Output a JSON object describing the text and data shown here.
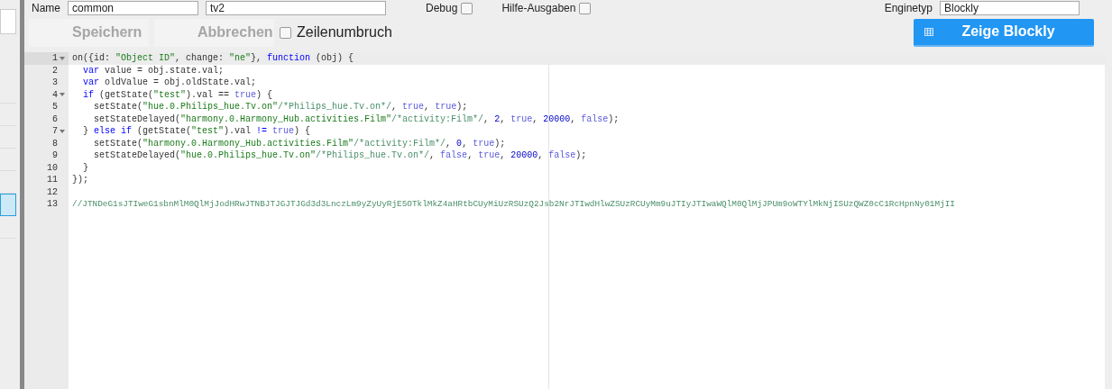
{
  "header": {
    "name_label": "Name",
    "group_select": "common",
    "name_value": "tv2",
    "debug": {
      "label": "Debug",
      "checked": false
    },
    "verbose": {
      "label": "Hilfe-Ausgaben",
      "checked": false
    },
    "engine_label": "Enginetyp",
    "engine_select": "Blockly"
  },
  "sidebar": {
    "rows": [
      {
        "selected": false
      },
      {
        "selected": false
      },
      {
        "selected": false
      },
      {
        "selected": false
      },
      {
        "selected": false
      },
      {
        "selected": true
      },
      {
        "selected": false
      }
    ]
  },
  "toolbar": {
    "save": {
      "label": "Speichern",
      "disabled": true
    },
    "cancel": {
      "label": "Abbrechen",
      "disabled": true
    },
    "wrap": {
      "label": "Zeilenumbruch",
      "checked": false
    },
    "blockly": {
      "label": "Zeige Blockly"
    }
  },
  "editor": {
    "lines": [
      {
        "number": "1",
        "foldable": true,
        "active": true,
        "tokens": [
          {
            "kind": "plain",
            "text": "on({id: "
          },
          {
            "kind": "string",
            "text": "\"Object ID\""
          },
          {
            "kind": "plain",
            "text": ", change: "
          },
          {
            "kind": "string",
            "text": "\"ne\""
          },
          {
            "kind": "plain",
            "text": "}, "
          },
          {
            "kind": "keyword",
            "text": "function"
          },
          {
            "kind": "plain",
            "text": " (obj) {"
          }
        ]
      },
      {
        "number": "2",
        "foldable": false,
        "active": false,
        "tokens": [
          {
            "kind": "keyword",
            "text": "  var"
          },
          {
            "kind": "plain",
            "text": " value = obj.state.val;"
          }
        ]
      },
      {
        "number": "3",
        "foldable": false,
        "active": false,
        "tokens": [
          {
            "kind": "keyword",
            "text": "  var"
          },
          {
            "kind": "plain",
            "text": " oldValue = obj.oldState.val;"
          }
        ]
      },
      {
        "number": "4",
        "foldable": true,
        "active": false,
        "tokens": [
          {
            "kind": "keyword",
            "text": "  if"
          },
          {
            "kind": "plain",
            "text": " (getState("
          },
          {
            "kind": "string",
            "text": "\"test\""
          },
          {
            "kind": "plain",
            "text": ").val == "
          },
          {
            "kind": "atom",
            "text": "true"
          },
          {
            "kind": "plain",
            "text": ") {"
          }
        ]
      },
      {
        "number": "5",
        "foldable": false,
        "active": false,
        "tokens": [
          {
            "kind": "plain",
            "text": "    setState("
          },
          {
            "kind": "string",
            "text": "\"hue.0.Philips_hue.Tv.on\""
          },
          {
            "kind": "comment",
            "text": "/*Philips_hue.Tv.on*/"
          },
          {
            "kind": "plain",
            "text": ", "
          },
          {
            "kind": "atom",
            "text": "true"
          },
          {
            "kind": "plain",
            "text": ", "
          },
          {
            "kind": "atom",
            "text": "true"
          },
          {
            "kind": "plain",
            "text": ");"
          }
        ]
      },
      {
        "number": "6",
        "foldable": false,
        "active": false,
        "tokens": [
          {
            "kind": "plain",
            "text": "    setStateDelayed("
          },
          {
            "kind": "string",
            "text": "\"harmony.0.Harmony_Hub.activities.Film\""
          },
          {
            "kind": "comment",
            "text": "/*activity:Film*/"
          },
          {
            "kind": "plain",
            "text": ", "
          },
          {
            "kind": "number",
            "text": "2"
          },
          {
            "kind": "plain",
            "text": ", "
          },
          {
            "kind": "atom",
            "text": "true"
          },
          {
            "kind": "plain",
            "text": ", "
          },
          {
            "kind": "number",
            "text": "20000"
          },
          {
            "kind": "plain",
            "text": ", "
          },
          {
            "kind": "atom",
            "text": "false"
          },
          {
            "kind": "plain",
            "text": ");"
          }
        ]
      },
      {
        "number": "7",
        "foldable": true,
        "active": false,
        "tokens": [
          {
            "kind": "plain",
            "text": "  } "
          },
          {
            "kind": "keyword",
            "text": "else if"
          },
          {
            "kind": "plain",
            "text": " (getState("
          },
          {
            "kind": "string",
            "text": "\"test\""
          },
          {
            "kind": "plain",
            "text": ").val "
          },
          {
            "kind": "keyword",
            "text": "!="
          },
          {
            "kind": "atom",
            "text": " true"
          },
          {
            "kind": "plain",
            "text": ") {"
          }
        ]
      },
      {
        "number": "8",
        "foldable": false,
        "active": false,
        "tokens": [
          {
            "kind": "plain",
            "text": "    setState("
          },
          {
            "kind": "string",
            "text": "\"harmony.0.Harmony_Hub.activities.Film\""
          },
          {
            "kind": "comment",
            "text": "/*activity:Film*/"
          },
          {
            "kind": "plain",
            "text": ", "
          },
          {
            "kind": "number",
            "text": "0"
          },
          {
            "kind": "plain",
            "text": ", "
          },
          {
            "kind": "atom",
            "text": "true"
          },
          {
            "kind": "plain",
            "text": ");"
          }
        ]
      },
      {
        "number": "9",
        "foldable": false,
        "active": false,
        "tokens": [
          {
            "kind": "plain",
            "text": "    setStateDelayed("
          },
          {
            "kind": "string",
            "text": "\"hue.0.Philips_hue.Tv.on\""
          },
          {
            "kind": "comment",
            "text": "/*Philips_hue.Tv.on*/"
          },
          {
            "kind": "plain",
            "text": ", "
          },
          {
            "kind": "atom",
            "text": "false"
          },
          {
            "kind": "plain",
            "text": ", "
          },
          {
            "kind": "atom",
            "text": "true"
          },
          {
            "kind": "plain",
            "text": ", "
          },
          {
            "kind": "number",
            "text": "20000"
          },
          {
            "kind": "plain",
            "text": ", "
          },
          {
            "kind": "atom",
            "text": "false"
          },
          {
            "kind": "plain",
            "text": ");"
          }
        ]
      },
      {
        "number": "10",
        "foldable": false,
        "active": false,
        "tokens": [
          {
            "kind": "plain",
            "text": "  }"
          }
        ]
      },
      {
        "number": "11",
        "foldable": false,
        "active": false,
        "tokens": [
          {
            "kind": "plain",
            "text": "});"
          }
        ]
      },
      {
        "number": "12",
        "foldable": false,
        "active": false
      },
      {
        "number": "13",
        "foldable": false,
        "active": false,
        "tokens": [
          {
            "kind": "comment",
            "text": "//JTNDeG1sJTIweG1sbnMlM0QlMjJodHRwJTNBJTJGJTJGd3d3LnczLm9yZyUyRjE5OTklMkZ4aHRtbCUyMiUzRSUzQ2Jsb2NrJTIwdHlwZSUzRCUyMm9uJTIyJTIwaWQlM0QlMjJPUm9oWTYlMkNjISUzQWZ0cC1RcHpnNy01MjII"
          }
        ]
      }
    ]
  }
}
